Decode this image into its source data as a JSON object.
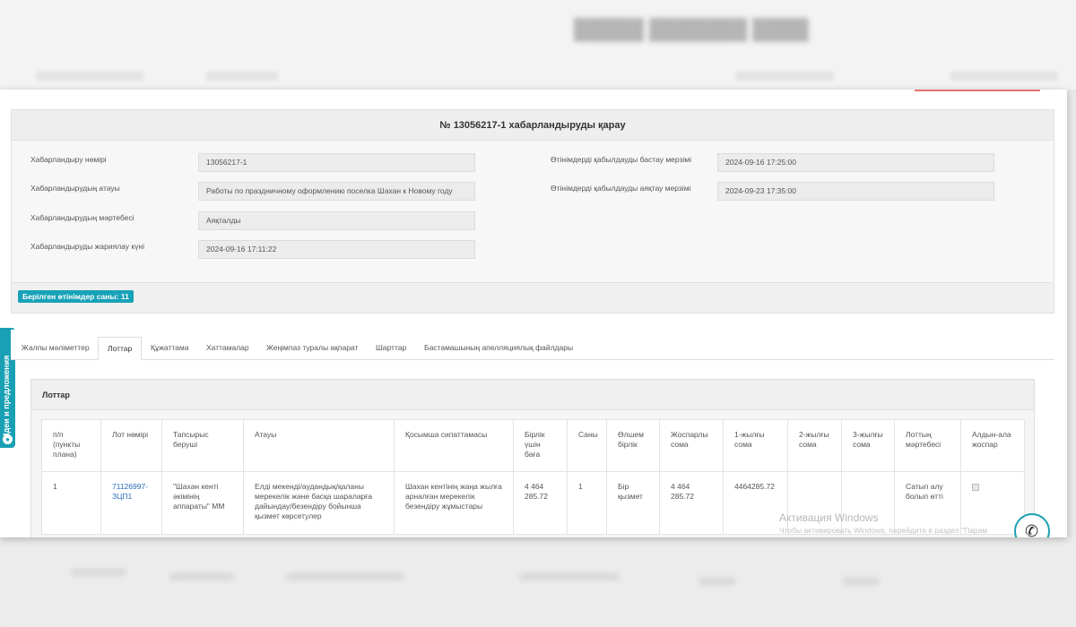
{
  "page": {
    "title": "№ 13056217-1 хабарландыруды қарау"
  },
  "fields": [
    {
      "label": "Хабарландыру нөмірі",
      "value": "13056217-1"
    },
    {
      "label": "Хабарландырудың атауы",
      "value": "Работы по праздничному оформлению поселка Шахан к Новому году"
    },
    {
      "label": "Хабарландырудың мәртебесі",
      "value": "Аяқталды"
    },
    {
      "label": "Хабарландыруды жариялау күні",
      "value": "2024-09-16 17:11:22"
    },
    {
      "label": "Өтінімдерді қабылдауды бастау мерзімі",
      "value": "2024-09-16 17:25:00"
    },
    {
      "label": "Өтінімдерді қабылдауды аяқтау мерзімі",
      "value": "2024-09-23 17:35:00"
    }
  ],
  "applications_badge": "Берілген өтінімдер саны: 11",
  "side_tab": {
    "label": "Идеи и предложения",
    "icon": "lightbulb-icon"
  },
  "tabs": [
    {
      "label": "Жалпы мәліметтер",
      "active": false
    },
    {
      "label": "Лоттар",
      "active": true
    },
    {
      "label": "Құжаттама",
      "active": false
    },
    {
      "label": "Хаттамалар",
      "active": false
    },
    {
      "label": "Жеңімпаз туралы ақпарат",
      "active": false
    },
    {
      "label": "Шарттар",
      "active": false
    },
    {
      "label": "Бастамашының апелляциялық файлдары",
      "active": false
    }
  ],
  "lots": {
    "title": "Лоттар",
    "columns": [
      "п/п (пункты плана)",
      "Лот нөмірі",
      "Тапсырыс беруші",
      "Атауы",
      "Қосымша сипаттамасы",
      "Бірлік үшін баға",
      "Саны",
      "Өлшем бірлік",
      "Жоспарлы сома",
      "1-жылғы сома",
      "2-жылғы сома",
      "3-жылғы сома",
      "Лоттың мәртебесі",
      "Алдын-ала жоспар"
    ],
    "rows": [
      {
        "num": "1",
        "lot_number": "71126997-ЗЦП1",
        "customer": "\"Шахан кенті әкімінің аппараты\" ММ",
        "name": "Елді мекенді/аудандық/қаланы мерекелік және басқа шараларға дайындау/безендіру бойынша қызмет көрсетулер",
        "description": "Шахан кентінің жаңа жылға арналған мерекелік безендіру жұмыстары",
        "unit_price": "4 464 285.72",
        "quantity": "1",
        "unit": "Бір қызмет",
        "planned_sum": "4 464 285.72",
        "sum_year1": "4464285.72",
        "sum_year2": "",
        "sum_year3": "",
        "status": "Сатып алу болып өтті",
        "preliminary": true
      }
    ]
  },
  "watermark": {
    "title": "Активация Windows",
    "subtitle": "Чтобы активировать Windows, перейдите в раздел \"Парам"
  },
  "phone_button": {
    "icon": "phone-icon"
  }
}
